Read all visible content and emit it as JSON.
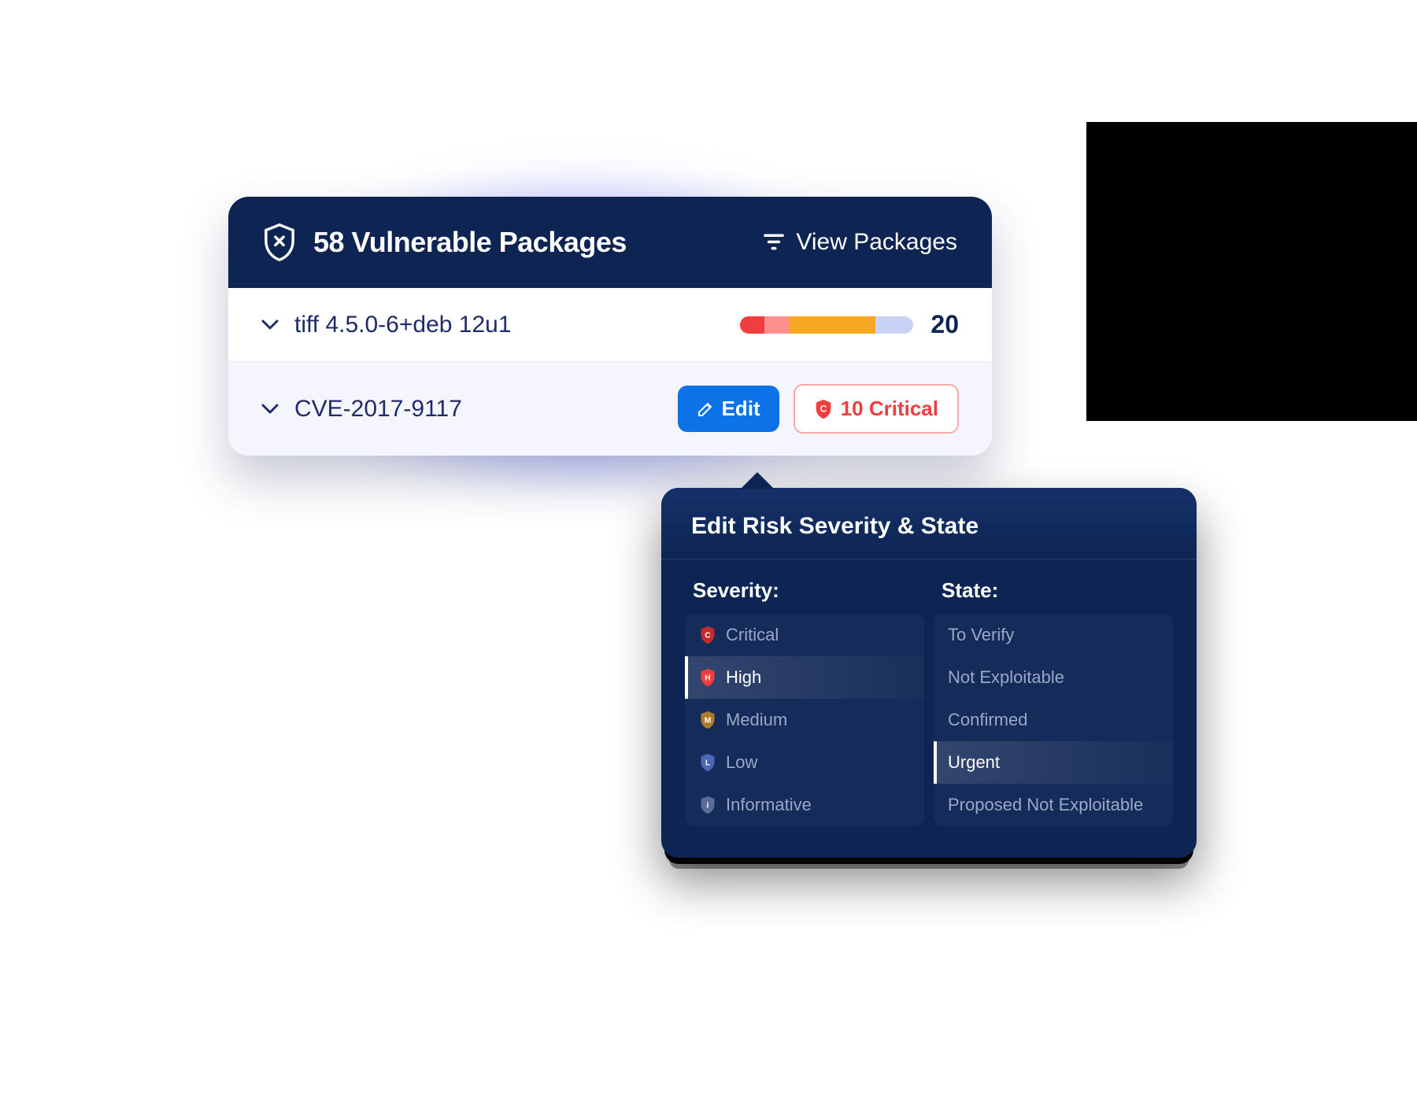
{
  "card": {
    "title": "58 Vulnerable Packages",
    "view_label": "View Packages"
  },
  "package_row": {
    "name": "tiff 4.5.0-6+deb 12u1",
    "count": "20",
    "bar": [
      {
        "color": "#f13d3d",
        "pct": 14
      },
      {
        "color": "#ff8f8f",
        "pct": 14
      },
      {
        "color": "#f7a823",
        "pct": 50
      },
      {
        "color": "#c9d3f5",
        "pct": 22
      }
    ]
  },
  "cve_row": {
    "name": "CVE-2017-9117",
    "edit_label": "Edit",
    "critical_label": "10 Critical"
  },
  "popover": {
    "title": "Edit Risk Severity & State",
    "severity_label": "Severity:",
    "state_label": "State:",
    "severity_options": [
      {
        "label": "Critical",
        "color": "#c22b2b",
        "letter": "C",
        "selected": false
      },
      {
        "label": "High",
        "color": "#f13d3d",
        "letter": "H",
        "selected": true
      },
      {
        "label": "Medium",
        "color": "#b07a2b",
        "letter": "M",
        "selected": false
      },
      {
        "label": "Low",
        "color": "#4a67b5",
        "letter": "L",
        "selected": false
      },
      {
        "label": "Informative",
        "color": "#5a6b95",
        "letter": "i",
        "selected": false
      }
    ],
    "state_options": [
      {
        "label": "To Verify",
        "selected": false
      },
      {
        "label": "Not Exploitable",
        "selected": false
      },
      {
        "label": "Confirmed",
        "selected": false
      },
      {
        "label": "Urgent",
        "selected": true
      },
      {
        "label": "Proposed Not Exploitable",
        "selected": false
      }
    ]
  }
}
